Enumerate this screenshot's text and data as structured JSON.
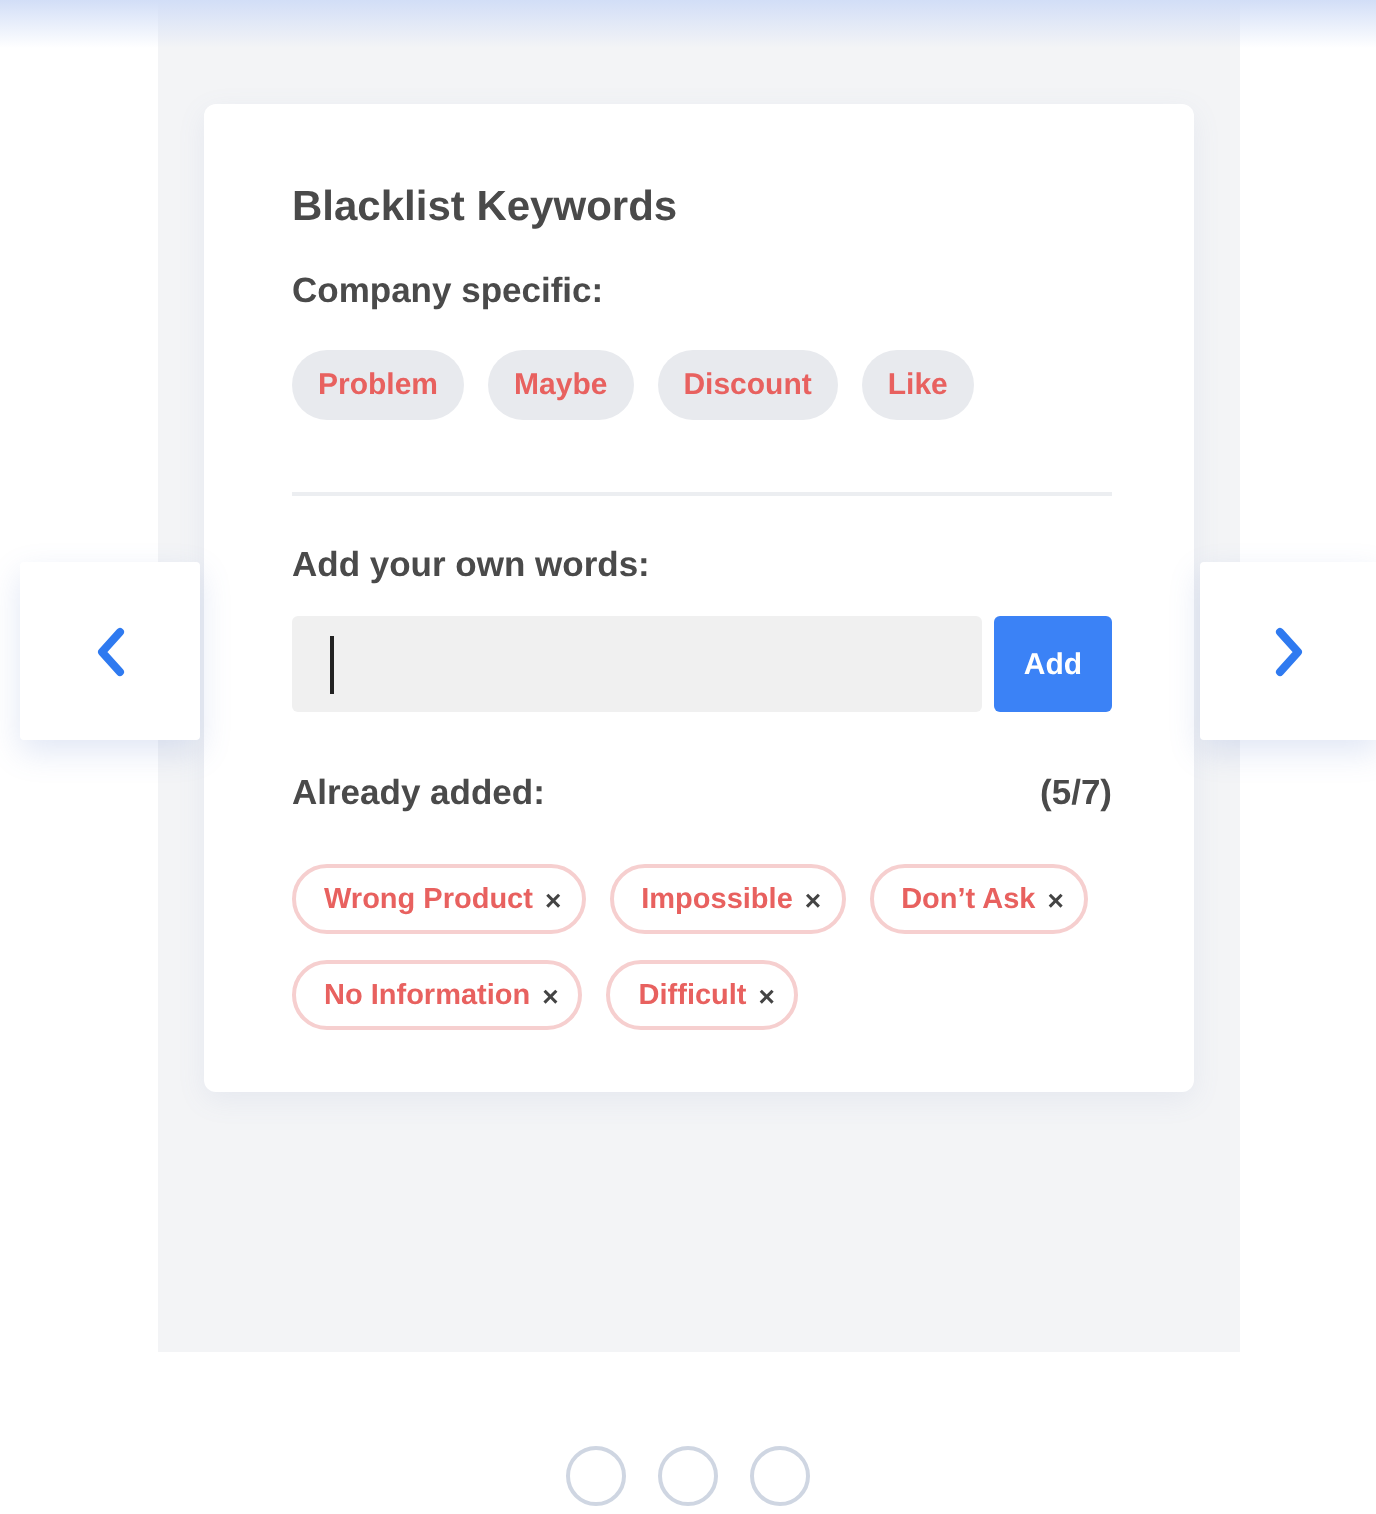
{
  "title": "Blacklist Keywords",
  "company_section": {
    "label": "Company specific:",
    "keywords": [
      "Problem",
      "Maybe",
      "Discount",
      "Like"
    ]
  },
  "add_section": {
    "label": "Add your own words:",
    "button": "Add"
  },
  "added_section": {
    "label": "Already added:",
    "count": "(5/7)",
    "remove_glyph": "×",
    "keywords": [
      "Wrong Product",
      "Impossible",
      "Don’t Ask",
      "No Information",
      "Difficult"
    ]
  },
  "pager": [
    {
      "selected": false
    },
    {
      "selected": false
    },
    {
      "selected": false
    }
  ]
}
